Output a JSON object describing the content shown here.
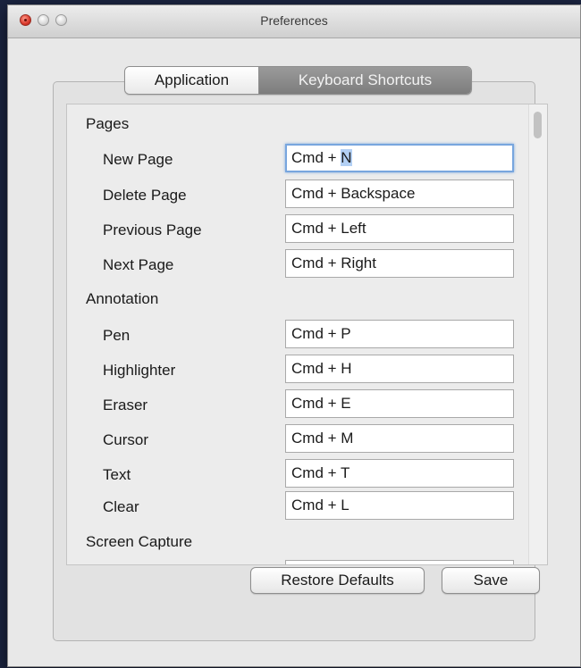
{
  "window": {
    "title": "Preferences"
  },
  "tabs": [
    {
      "label": "Application",
      "active": false
    },
    {
      "label": "Keyboard Shortcuts",
      "active": true
    }
  ],
  "sections": [
    {
      "title": "Pages",
      "items": [
        {
          "label": "New Page",
          "shortcut_prefix": "Cmd + ",
          "shortcut_selected": "N"
        },
        {
          "label": "Delete Page",
          "shortcut": "Cmd + Backspace"
        },
        {
          "label": "Previous Page",
          "shortcut": "Cmd + Left"
        },
        {
          "label": "Next Page",
          "shortcut": "Cmd + Right"
        }
      ]
    },
    {
      "title": "Annotation",
      "items": [
        {
          "label": "Pen",
          "shortcut": "Cmd + P"
        },
        {
          "label": "Highlighter",
          "shortcut": "Cmd + H"
        },
        {
          "label": "Eraser",
          "shortcut": "Cmd + E"
        },
        {
          "label": "Cursor",
          "shortcut": "Cmd + M"
        },
        {
          "label": "Text",
          "shortcut": "Cmd + T"
        },
        {
          "label": "Clear",
          "shortcut": "Cmd + L"
        }
      ]
    },
    {
      "title": "Screen Capture",
      "items": []
    }
  ],
  "buttons": {
    "restore_defaults": "Restore Defaults",
    "save": "Save"
  },
  "icons": {
    "close": "close-icon",
    "minimize": "minimize-icon",
    "zoom": "zoom-icon"
  }
}
